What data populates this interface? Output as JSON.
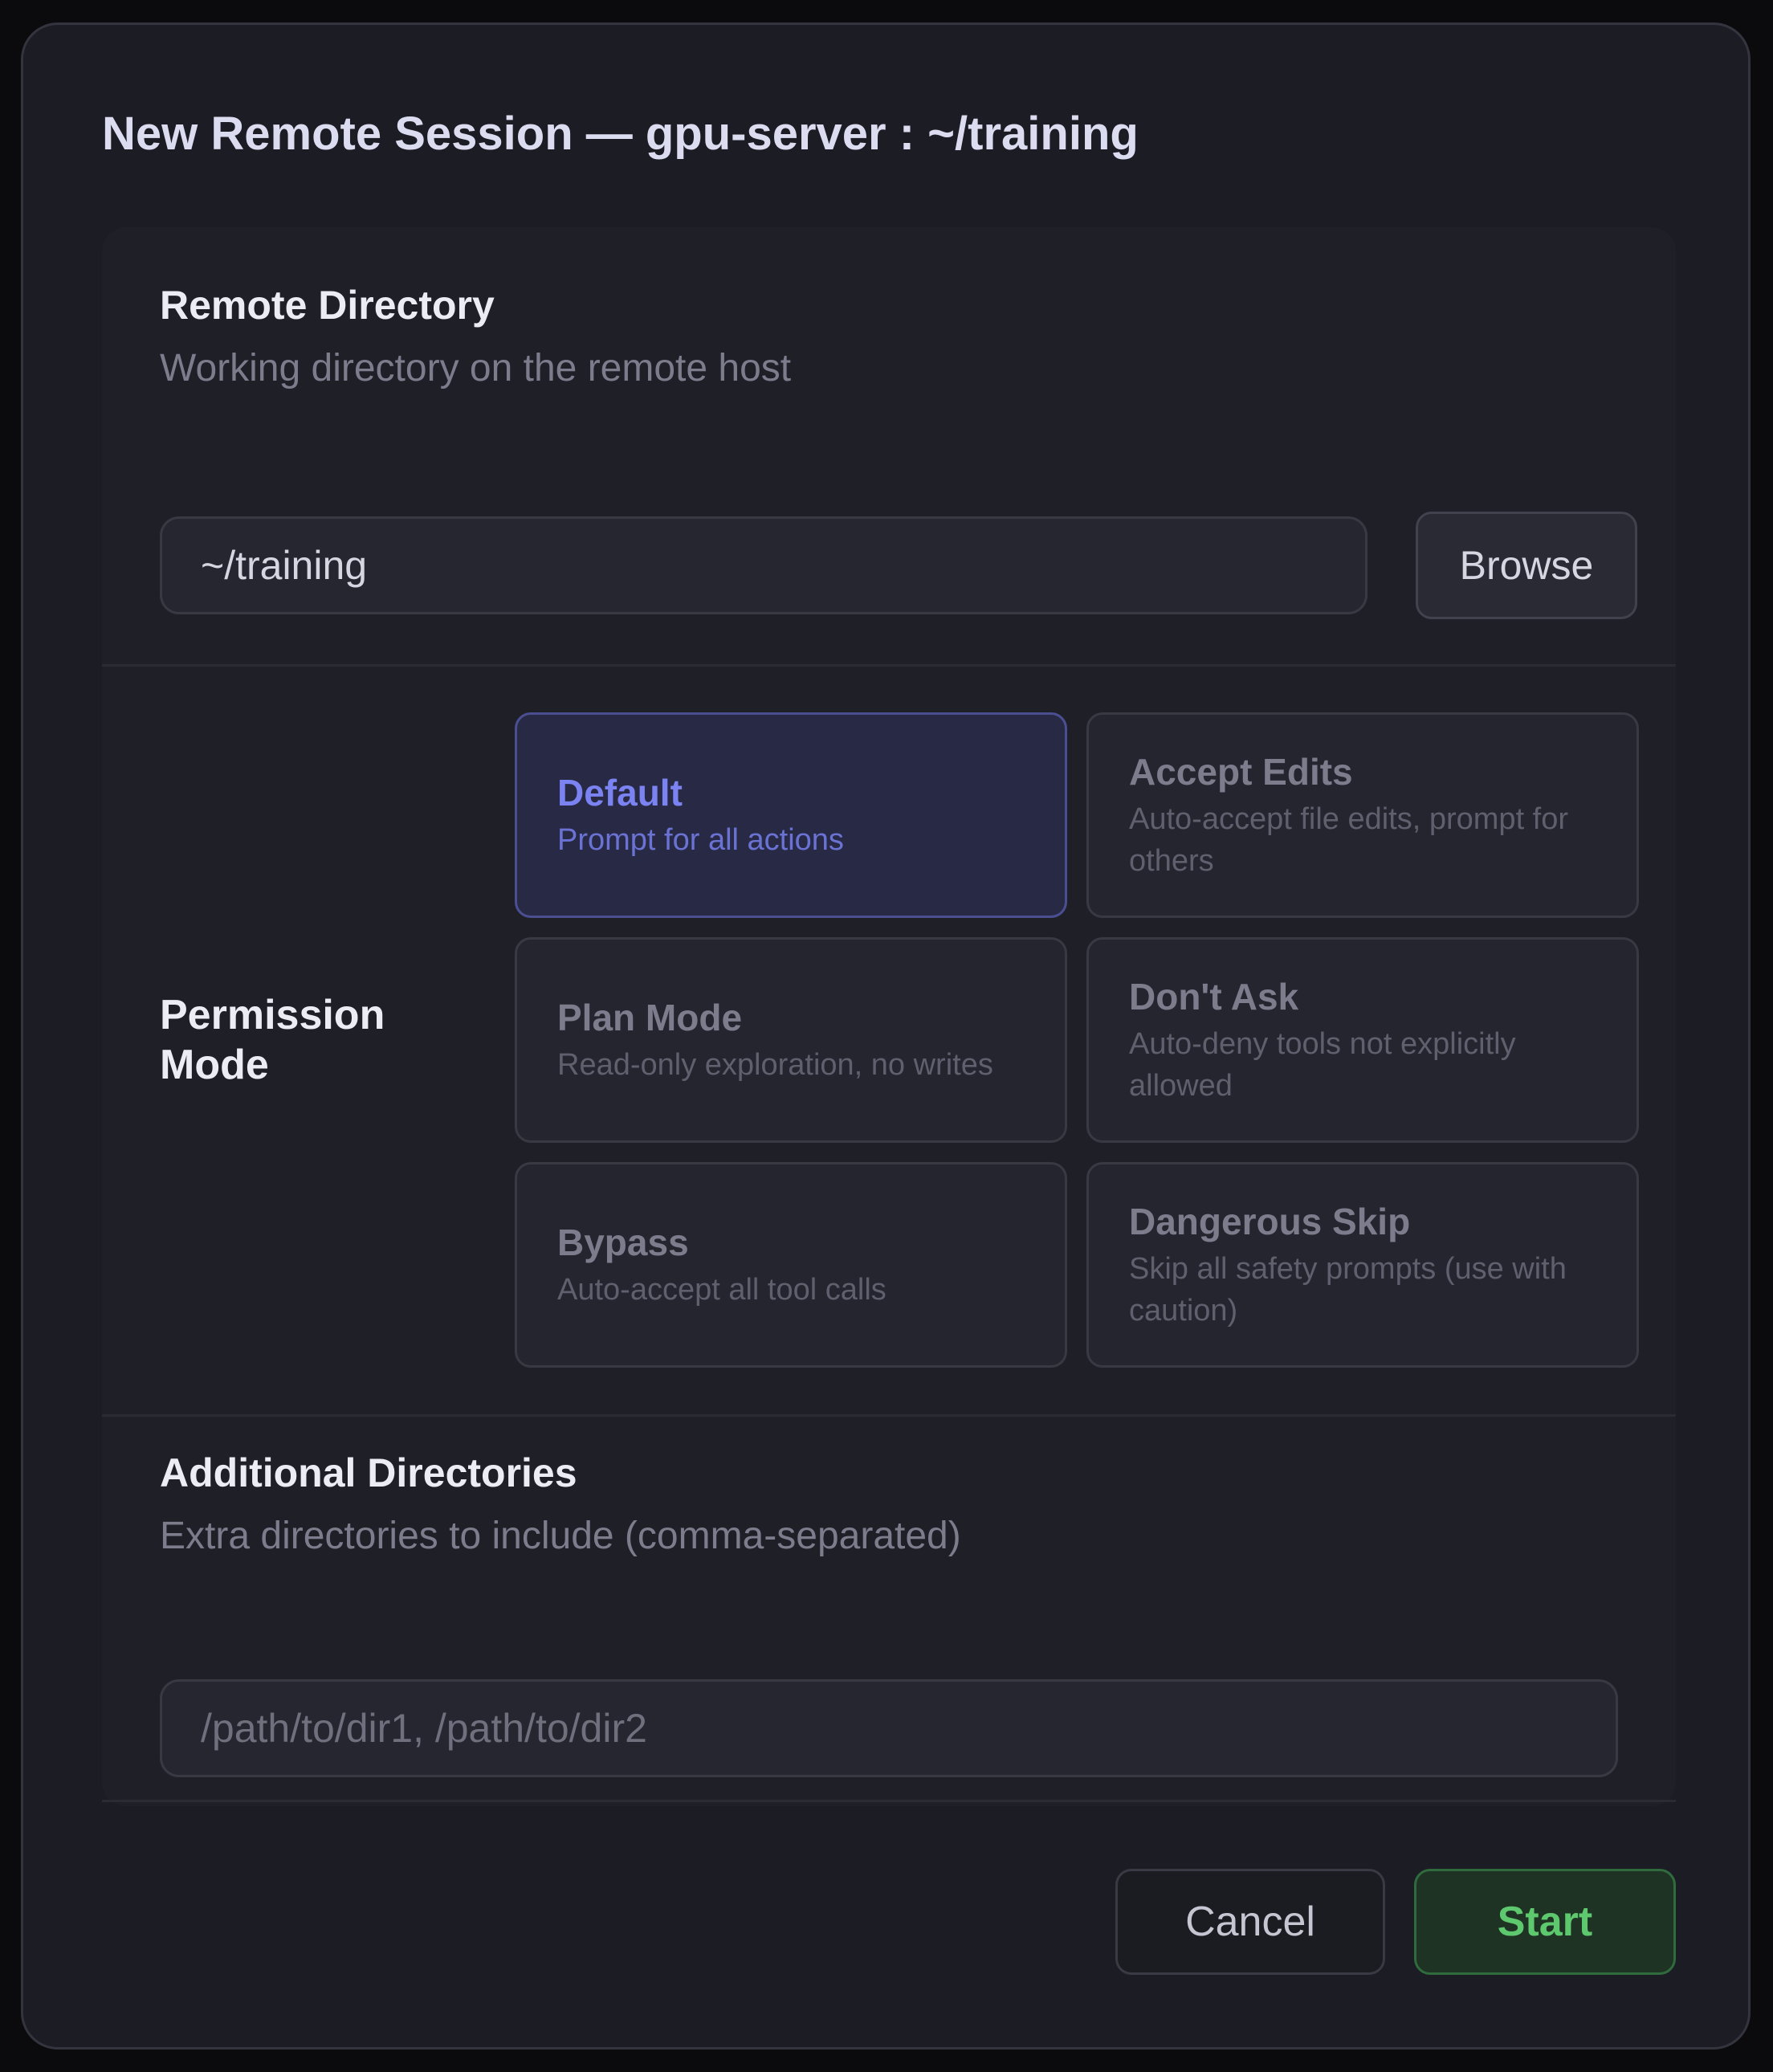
{
  "dialog": {
    "title": "New Remote Session — gpu-server : ~/training"
  },
  "remote_directory": {
    "label": "Remote Directory",
    "hint": "Working directory on the remote host",
    "value": "~/training",
    "browse_label": "Browse"
  },
  "permission_mode": {
    "label": "Permission Mode",
    "selected": "Default",
    "options": [
      {
        "name": "Default",
        "description": "Prompt for all actions"
      },
      {
        "name": "Accept Edits",
        "description": "Auto-accept file edits, prompt for others"
      },
      {
        "name": "Plan Mode",
        "description": "Read-only exploration, no writes"
      },
      {
        "name": "Don't Ask",
        "description": "Auto-deny tools not explicitly allowed"
      },
      {
        "name": "Bypass",
        "description": "Auto-accept all tool calls"
      },
      {
        "name": "Dangerous Skip",
        "description": "Skip all safety prompts (use with caution)"
      }
    ]
  },
  "additional_directories": {
    "label": "Additional Directories",
    "hint": "Extra directories to include (comma-separated)",
    "value": "",
    "placeholder": "/path/to/dir1, /path/to/dir2"
  },
  "footer": {
    "cancel_label": "Cancel",
    "start_label": "Start"
  },
  "colors": {
    "accent": "#7b83f2",
    "start": "#5ec86e",
    "background": "#1c1c24"
  }
}
